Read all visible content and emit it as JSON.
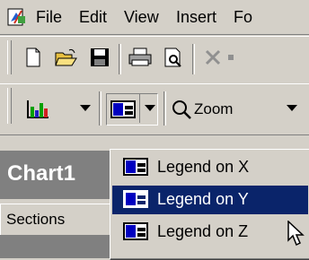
{
  "menubar": {
    "items": [
      "File",
      "Edit",
      "View",
      "Insert",
      "Fo"
    ]
  },
  "toolbar2": {
    "zoom_label": "Zoom"
  },
  "chart_window": {
    "title": "Chart1"
  },
  "sections_bar": {
    "label": "Sections"
  },
  "legend_dropdown": {
    "items": [
      {
        "label": "Legend on X",
        "icon": "legend-on-x-icon",
        "highlighted": false
      },
      {
        "label": "Legend on Y",
        "icon": "legend-on-y-icon",
        "highlighted": true
      },
      {
        "label": "Legend on Z",
        "icon": "legend-on-z-icon",
        "highlighted": false
      }
    ]
  },
  "colors": {
    "highlight": "#0a246a",
    "face": "#d4d0c8",
    "dark_gray": "#808080"
  }
}
